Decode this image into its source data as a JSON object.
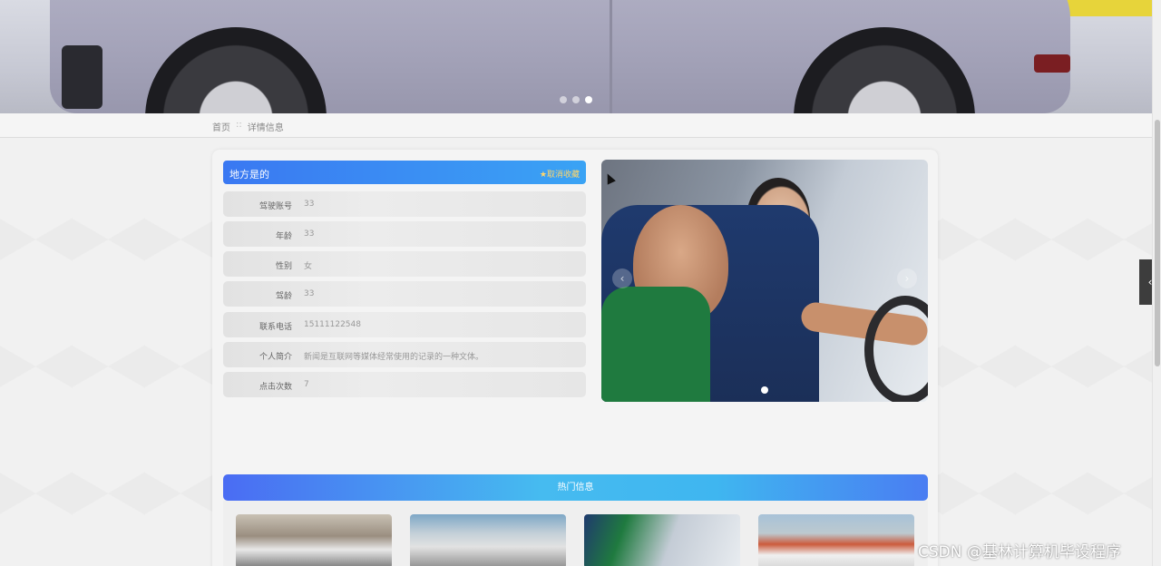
{
  "breadcrumb": {
    "home": "首页",
    "separator": "::",
    "current": "详情信息"
  },
  "detail": {
    "title": "地方是的",
    "favorite_label": "★取消收藏",
    "fields": [
      {
        "label": "驾驶账号",
        "value": "33"
      },
      {
        "label": "年龄",
        "value": "33"
      },
      {
        "label": "性别",
        "value": "女"
      },
      {
        "label": "驾龄",
        "value": "33"
      },
      {
        "label": "联系电话",
        "value": "15111122548"
      },
      {
        "label": "个人简介",
        "value": "新闻是互联网等媒体经常使用的记录的一种文体。"
      },
      {
        "label": "点击次数",
        "value": "7"
      }
    ]
  },
  "hot": {
    "title": "热门信息"
  },
  "side_tab": {
    "icon": "‹"
  },
  "watermark": "CSDN @基林计算机毕设程序",
  "colors": {
    "title_gradient_start": "#3a78f2",
    "title_gradient_end": "#3aa3f4",
    "favorite": "#ffd66b",
    "hot_gradient_mid": "#46bbf0"
  },
  "banner": {
    "slides": 3,
    "active_slide": 3
  }
}
